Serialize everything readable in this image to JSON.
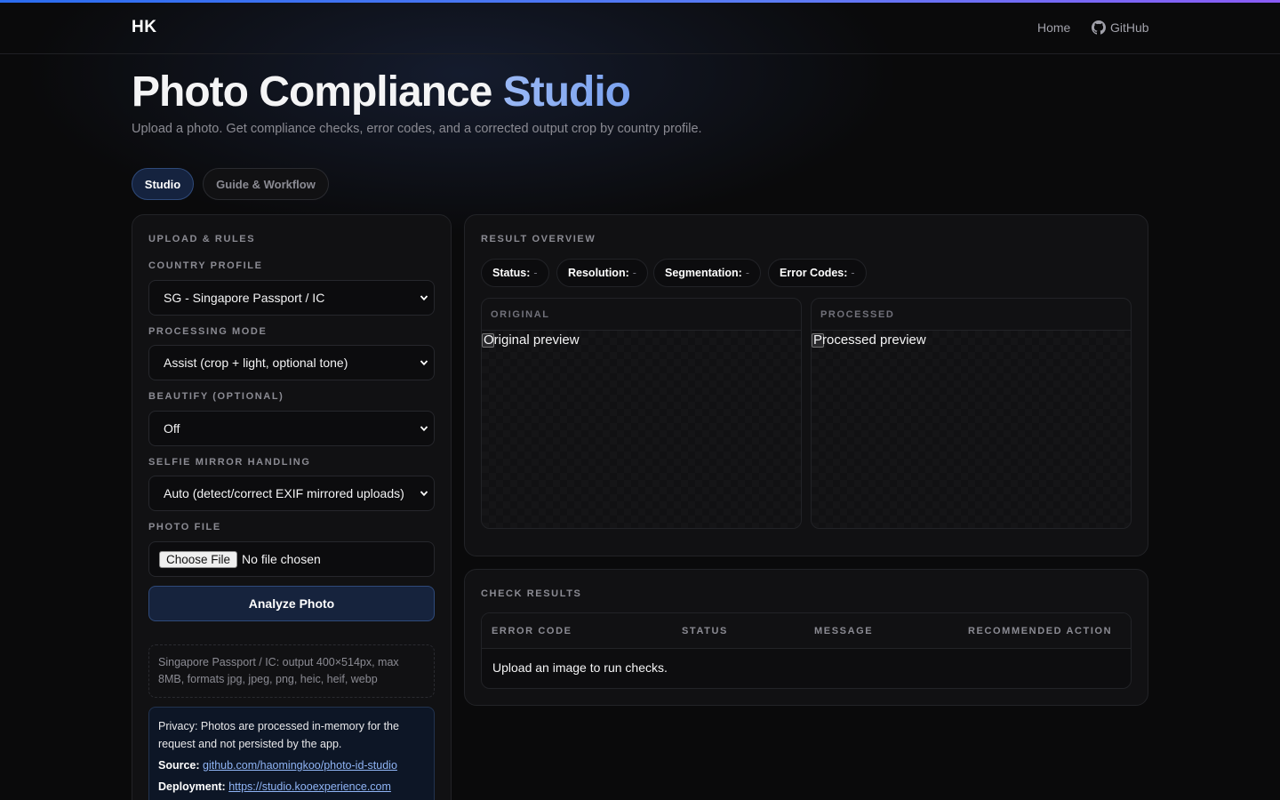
{
  "header": {
    "logo": "HK",
    "nav": {
      "home": "Home",
      "github": "GitHub"
    }
  },
  "hero": {
    "title_main": "Photo Compliance",
    "title_accent": "Studio",
    "subtitle": "Upload a photo. Get compliance checks, error codes, and a corrected output crop by country profile."
  },
  "tabs": [
    {
      "label": "Studio",
      "active": true
    },
    {
      "label": "Guide & Workflow",
      "active": false
    }
  ],
  "upload_panel": {
    "title": "UPLOAD & RULES",
    "country_profile": {
      "label": "COUNTRY PROFILE",
      "value": "SG - Singapore Passport / IC"
    },
    "processing_mode": {
      "label": "PROCESSING MODE",
      "value": "Assist (crop + light, optional tone)"
    },
    "beautify": {
      "label": "BEAUTIFY (OPTIONAL)",
      "value": "Off"
    },
    "mirror": {
      "label": "SELFIE MIRROR HANDLING",
      "value": "Auto (detect/correct EXIF mirrored uploads)"
    },
    "photo_file": {
      "label": "PHOTO FILE",
      "button": "Choose File",
      "status": "No file chosen"
    },
    "analyze_button": "Analyze Photo",
    "profile_info": "Singapore Passport / IC: output 400×514px, max 8MB, formats jpg, jpeg, png, heic, heif, webp",
    "privacy": {
      "text": "Privacy: Photos are processed in-memory for the request and not persisted by the app.",
      "source_label": "Source:",
      "source_link": "github.com/haomingkoo/photo-id-studio",
      "deployment_label": "Deployment:",
      "deployment_link": "https://studio.kooexperience.com"
    }
  },
  "result_overview": {
    "title": "RESULT OVERVIEW",
    "pills": [
      {
        "label": "Status:",
        "value": "-"
      },
      {
        "label": "Resolution:",
        "value": "-"
      },
      {
        "label": "Segmentation:",
        "value": "-"
      },
      {
        "label": "Error Codes:",
        "value": "-"
      }
    ],
    "original": {
      "label": "ORIGINAL",
      "alt": "Original preview"
    },
    "processed": {
      "label": "PROCESSED",
      "alt": "Processed preview"
    }
  },
  "check_results": {
    "title": "CHECK RESULTS",
    "columns": [
      "ERROR CODE",
      "STATUS",
      "MESSAGE",
      "RECOMMENDED ACTION"
    ],
    "empty_message": "Upload an image to run checks."
  },
  "colors": {
    "accent": "#8fb4f5",
    "background": "#0a0a0b",
    "panel": "#111113",
    "active_tab": "#15233f"
  }
}
